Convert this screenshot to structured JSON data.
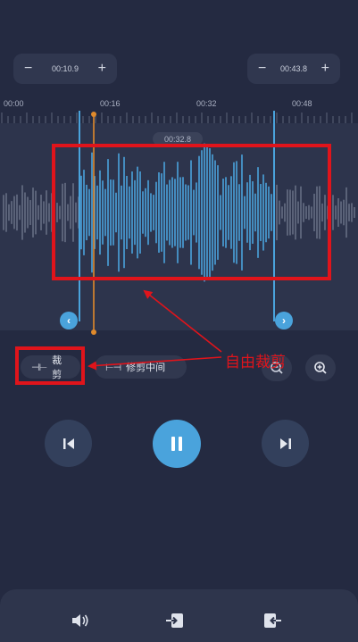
{
  "time_controls": {
    "left": {
      "minus": "−",
      "value": "00:10.9",
      "plus": "+"
    },
    "right": {
      "minus": "−",
      "value": "00:43.8",
      "plus": "+"
    }
  },
  "ruler": {
    "labels": [
      "00:00",
      "00:16",
      "00:32",
      "00:48"
    ]
  },
  "playhead_time": "00:32.8",
  "handles": {
    "left": "‹",
    "right": "›"
  },
  "modes": {
    "trim": {
      "icon": "⊣⊢",
      "label": "裁剪"
    },
    "trim_middle": {
      "icon": "⊢⊣",
      "label": "修剪中间"
    }
  },
  "annotation": {
    "label": "自由裁剪"
  },
  "colors": {
    "background": "#242a41",
    "waveform_selected": "#4aa3dc",
    "waveform_unselected": "#6a7287",
    "playhead": "#e08a2c",
    "annotation": "#e0141b"
  }
}
